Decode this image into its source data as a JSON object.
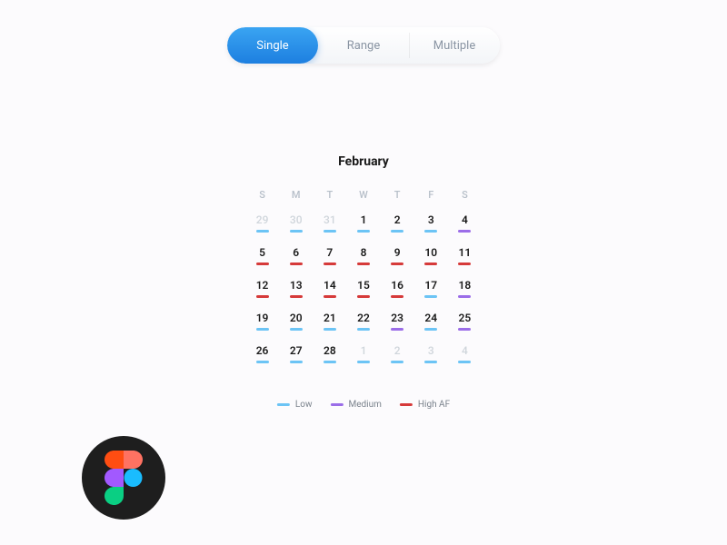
{
  "tabs": {
    "single": "Single",
    "range": "Range",
    "multiple": "Multiple",
    "active": "single"
  },
  "calendar": {
    "month_label": "February",
    "dow": [
      "S",
      "M",
      "T",
      "W",
      "T",
      "F",
      "S"
    ],
    "weeks": [
      [
        {
          "n": "29",
          "out": true,
          "lvl": "low"
        },
        {
          "n": "30",
          "out": true,
          "lvl": "low"
        },
        {
          "n": "31",
          "out": true,
          "lvl": "low"
        },
        {
          "n": "1",
          "out": false,
          "lvl": "low"
        },
        {
          "n": "2",
          "out": false,
          "lvl": "low"
        },
        {
          "n": "3",
          "out": false,
          "lvl": "low"
        },
        {
          "n": "4",
          "out": false,
          "lvl": "medium"
        }
      ],
      [
        {
          "n": "5",
          "out": false,
          "lvl": "high"
        },
        {
          "n": "6",
          "out": false,
          "lvl": "high"
        },
        {
          "n": "7",
          "out": false,
          "lvl": "high"
        },
        {
          "n": "8",
          "out": false,
          "lvl": "high"
        },
        {
          "n": "9",
          "out": false,
          "lvl": "high"
        },
        {
          "n": "10",
          "out": false,
          "lvl": "high"
        },
        {
          "n": "11",
          "out": false,
          "lvl": "high"
        }
      ],
      [
        {
          "n": "12",
          "out": false,
          "lvl": "high"
        },
        {
          "n": "13",
          "out": false,
          "lvl": "high"
        },
        {
          "n": "14",
          "out": false,
          "lvl": "high"
        },
        {
          "n": "15",
          "out": false,
          "lvl": "high"
        },
        {
          "n": "16",
          "out": false,
          "lvl": "high"
        },
        {
          "n": "17",
          "out": false,
          "lvl": "low"
        },
        {
          "n": "18",
          "out": false,
          "lvl": "medium"
        }
      ],
      [
        {
          "n": "19",
          "out": false,
          "lvl": "low"
        },
        {
          "n": "20",
          "out": false,
          "lvl": "low"
        },
        {
          "n": "21",
          "out": false,
          "lvl": "low"
        },
        {
          "n": "22",
          "out": false,
          "lvl": "low"
        },
        {
          "n": "23",
          "out": false,
          "lvl": "medium"
        },
        {
          "n": "24",
          "out": false,
          "lvl": "low"
        },
        {
          "n": "25",
          "out": false,
          "lvl": "medium"
        }
      ],
      [
        {
          "n": "26",
          "out": false,
          "lvl": "low"
        },
        {
          "n": "27",
          "out": false,
          "lvl": "low"
        },
        {
          "n": "28",
          "out": false,
          "lvl": "low"
        },
        {
          "n": "1",
          "out": true,
          "lvl": "low"
        },
        {
          "n": "2",
          "out": true,
          "lvl": "low"
        },
        {
          "n": "3",
          "out": true,
          "lvl": "low"
        },
        {
          "n": "4",
          "out": true,
          "lvl": "low"
        }
      ]
    ]
  },
  "legend": {
    "low": {
      "label": "Low",
      "color": "#6cc4f5"
    },
    "medium": {
      "label": "Medium",
      "color": "#9b6de8"
    },
    "high": {
      "label": "High AF",
      "color": "#d63a3a"
    }
  },
  "badge": {
    "brand": "figma"
  }
}
